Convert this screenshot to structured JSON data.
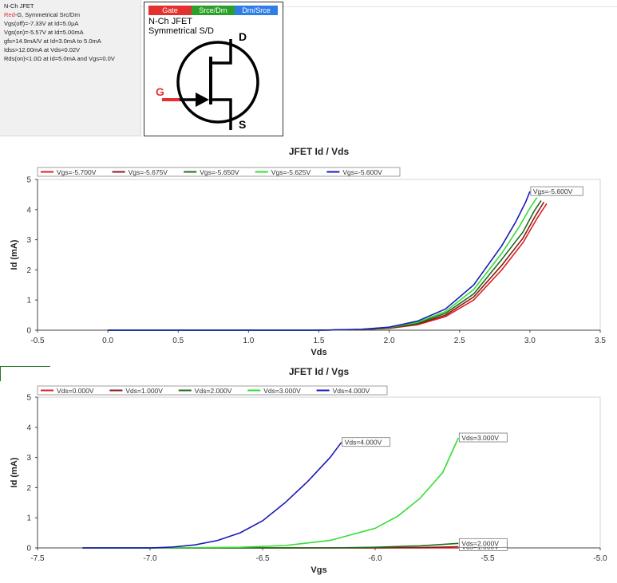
{
  "info": {
    "line1": "N-Ch JFET",
    "line2_red": "Red",
    "line2_rest": "-G, Symmetrical Src/Drn",
    "line3": "Vgs(off)=-7.33V at Id=5.0µA",
    "line4": "Vgs(on)=-5.57V at Id=5.00mA",
    "line5": "gfs=14.9mA/V at Id=3.0mA to 5.0mA",
    "line6": "Idss>12.00mA at Vds=0.02V",
    "line7": "Rds(on)<1.0Ω at Id=5.0mA and Vgs=0.0V"
  },
  "symbol": {
    "tab_gate": "Gate",
    "tab_src": "Srce/Drn",
    "tab_drn": "Drn/Srce",
    "title1": "N-Ch JFET",
    "title2": "Symmetrical S/D",
    "pin_d": "D",
    "pin_s": "S",
    "pin_g": "G",
    "colors": {
      "gate": "#e53030",
      "src": "#2aa02a",
      "drn": "#2f7ee6"
    }
  },
  "chart_data": [
    {
      "type": "line",
      "title": "JFET Id / Vds",
      "xlabel": "Vds",
      "ylabel": "Id (mA)",
      "xlim": [
        -0.5,
        3.5
      ],
      "ylim": [
        0,
        5
      ],
      "xticks": [
        "-0.5",
        "0.0",
        "0.5",
        "1.0",
        "1.5",
        "2.0",
        "2.5",
        "3.0",
        "3.5"
      ],
      "yticks": [
        "0",
        "1",
        "2",
        "3",
        "4",
        "5"
      ],
      "legend_position": "top",
      "series": [
        {
          "name": "Vgs=-5.700V",
          "color": "#e02020",
          "end_label": "",
          "x": [
            0.0,
            1.5,
            1.8,
            2.0,
            2.2,
            2.4,
            2.6,
            2.8,
            2.95,
            3.05,
            3.12
          ],
          "y": [
            0.0,
            0.0,
            0.02,
            0.06,
            0.18,
            0.45,
            1.0,
            2.0,
            2.9,
            3.7,
            4.2
          ]
        },
        {
          "name": "Vgs=-5.675V",
          "color": "#8b1a1a",
          "end_label": "",
          "x": [
            0.0,
            1.5,
            1.8,
            2.0,
            2.2,
            2.4,
            2.6,
            2.8,
            2.95,
            3.04,
            3.1
          ],
          "y": [
            0.0,
            0.0,
            0.02,
            0.07,
            0.2,
            0.5,
            1.1,
            2.15,
            3.05,
            3.8,
            4.25
          ]
        },
        {
          "name": "Vgs=-5.650V",
          "color": "#1e6b1e",
          "end_label": "",
          "x": [
            0.0,
            1.5,
            1.8,
            2.0,
            2.2,
            2.4,
            2.6,
            2.8,
            2.95,
            3.03,
            3.08
          ],
          "y": [
            0.0,
            0.0,
            0.02,
            0.08,
            0.23,
            0.56,
            1.2,
            2.35,
            3.25,
            3.95,
            4.3
          ]
        },
        {
          "name": "Vgs=-5.625V",
          "color": "#33dd33",
          "end_label": "",
          "x": [
            0.0,
            1.5,
            1.8,
            2.0,
            2.2,
            2.4,
            2.6,
            2.8,
            2.92,
            3.0,
            3.05
          ],
          "y": [
            0.0,
            0.0,
            0.03,
            0.09,
            0.26,
            0.62,
            1.35,
            2.55,
            3.4,
            4.05,
            4.4
          ]
        },
        {
          "name": "Vgs=-5.600V",
          "color": "#1a1ab8",
          "end_label": "Vgs=-5.600V",
          "x": [
            0.0,
            1.5,
            1.8,
            2.0,
            2.2,
            2.4,
            2.6,
            2.8,
            2.9,
            2.97,
            3.0
          ],
          "y": [
            0.0,
            0.0,
            0.03,
            0.1,
            0.3,
            0.7,
            1.5,
            2.8,
            3.6,
            4.25,
            4.6
          ]
        }
      ]
    },
    {
      "type": "line",
      "title": "JFET Id / Vgs",
      "xlabel": "Vgs",
      "ylabel": "Id (mA)",
      "xlim": [
        -7.5,
        -5.0
      ],
      "ylim": [
        0,
        5
      ],
      "xticks": [
        "-7.5",
        "-7.0",
        "-6.5",
        "-6.0",
        "-5.5",
        "-5.0"
      ],
      "yticks": [
        "0",
        "1",
        "2",
        "3",
        "4",
        "5"
      ],
      "legend_position": "top",
      "series": [
        {
          "name": "Vds=0.000V",
          "color": "#e02020",
          "end_label": "",
          "x": [
            -7.3,
            -5.63
          ],
          "y": [
            0.0,
            0.0
          ]
        },
        {
          "name": "Vds=1.000V",
          "color": "#8b1a1a",
          "end_label": "Vds=1.000V",
          "x": [
            -7.3,
            -6.0,
            -5.8,
            -5.63
          ],
          "y": [
            0.0,
            0.0,
            0.01,
            0.04
          ]
        },
        {
          "name": "Vds=2.000V",
          "color": "#1e6b1e",
          "end_label": "Vds=2.000V",
          "x": [
            -7.3,
            -6.2,
            -6.0,
            -5.8,
            -5.63
          ],
          "y": [
            0.0,
            0.0,
            0.02,
            0.07,
            0.15
          ]
        },
        {
          "name": "Vds=3.000V",
          "color": "#33dd33",
          "end_label": "Vds=3.000V",
          "x": [
            -7.3,
            -6.9,
            -6.6,
            -6.4,
            -6.2,
            -6.0,
            -5.9,
            -5.8,
            -5.7,
            -5.63
          ],
          "y": [
            0.0,
            0.0,
            0.02,
            0.08,
            0.25,
            0.65,
            1.05,
            1.65,
            2.5,
            3.65
          ]
        },
        {
          "name": "Vds=4.000V",
          "color": "#1a1ab8",
          "end_label": "Vds=4.000V",
          "x": [
            -7.3,
            -7.0,
            -6.9,
            -6.8,
            -6.7,
            -6.6,
            -6.5,
            -6.4,
            -6.3,
            -6.2,
            -6.15
          ],
          "y": [
            0.0,
            0.0,
            0.03,
            0.1,
            0.25,
            0.5,
            0.9,
            1.5,
            2.2,
            3.0,
            3.5
          ]
        }
      ]
    }
  ]
}
